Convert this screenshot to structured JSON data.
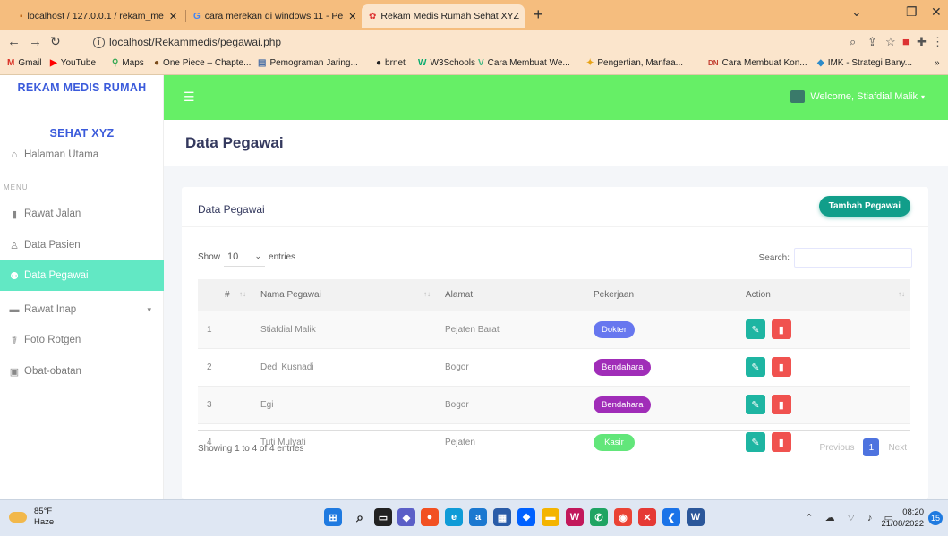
{
  "browser": {
    "tabs": [
      {
        "title": "localhost / 127.0.0.1 / rekam_me",
        "active": false
      },
      {
        "title": "cara merekan di windows 11 - Pe",
        "active": false
      },
      {
        "title": "Rekam Medis Rumah Sehat XYZ",
        "active": true
      }
    ],
    "new_tab": "+",
    "url": "localhost/Rekammedis/pegawai.php",
    "bookmarks": [
      {
        "label": "Gmail",
        "icon": "gmail-icon"
      },
      {
        "label": "YouTube",
        "icon": "youtube-icon"
      },
      {
        "label": "Maps",
        "icon": "maps-icon"
      },
      {
        "label": "One Piece – Chapte...",
        "icon": "onepiece-icon"
      },
      {
        "label": "Pemograman Jaring...",
        "icon": "doc-icon"
      },
      {
        "label": "brnet",
        "icon": "github-icon"
      },
      {
        "label": "W3Schools",
        "icon": "w3schools-icon"
      },
      {
        "label": "Cara Membuat We...",
        "icon": "vue-icon"
      },
      {
        "label": "Pengertian, Manfaa...",
        "icon": "star-icon"
      },
      {
        "label": "Cara Membuat Kon...",
        "icon": "dn-icon"
      },
      {
        "label": "IMK - Strategi Bany...",
        "icon": "imk-icon"
      }
    ],
    "bookmarks_more": "»"
  },
  "sidebar": {
    "brand_line1": "REKAM MEDIS RUMAH",
    "brand_line2": "SEHAT XYZ",
    "home": "Halaman Utama",
    "menu_header": "MENU",
    "items": [
      {
        "label": "Rawat Jalan",
        "icon": "file-icon"
      },
      {
        "label": "Data Pasien",
        "icon": "user-icon"
      },
      {
        "label": "Data Pegawai",
        "icon": "users-icon",
        "active": true
      },
      {
        "label": "Rawat Inap",
        "icon": "bed-icon",
        "has_submenu": true
      },
      {
        "label": "Foto Rotgen",
        "icon": "xray-icon"
      },
      {
        "label": "Obat-obatan",
        "icon": "medicine-icon"
      }
    ]
  },
  "topnav": {
    "user_greeting": "Welcome, Stiafdial Malik",
    "accent": "#66ef66"
  },
  "page": {
    "title": "Data Pegawai",
    "card_title": "Data Pegawai",
    "add_button": "Tambah Pegawai",
    "show_label": "Show",
    "entries_value": "10",
    "entries_label": "entries",
    "search_label": "Search:",
    "columns": [
      "#",
      "Nama Pegawai",
      "Alamat",
      "Pekerjaan",
      "Action"
    ],
    "rows": [
      {
        "no": "1",
        "nama": "Stiafdial Malik",
        "alamat": "Pejaten Barat",
        "pekerjaan": "Dokter",
        "badge_color": "#6777ef"
      },
      {
        "no": "2",
        "nama": "Dedi Kusnadi",
        "alamat": "Bogor",
        "pekerjaan": "Bendahara",
        "badge_color": "#a02db8"
      },
      {
        "no": "3",
        "nama": "Egi",
        "alamat": "Bogor",
        "pekerjaan": "Bendahara",
        "badge_color": "#a02db8"
      },
      {
        "no": "4",
        "nama": "Tuti Mulyati",
        "alamat": "Pejaten",
        "pekerjaan": "Kasir",
        "badge_color": "#62e67a"
      }
    ],
    "info": "Showing 1 to 4 of 4 entries",
    "pager": {
      "previous": "Previous",
      "current": "1",
      "next": "Next"
    }
  },
  "taskbar": {
    "temp": "85°F",
    "weather": "Haze",
    "time": "08:20",
    "date": "21/08/2022",
    "notifications": "15"
  }
}
